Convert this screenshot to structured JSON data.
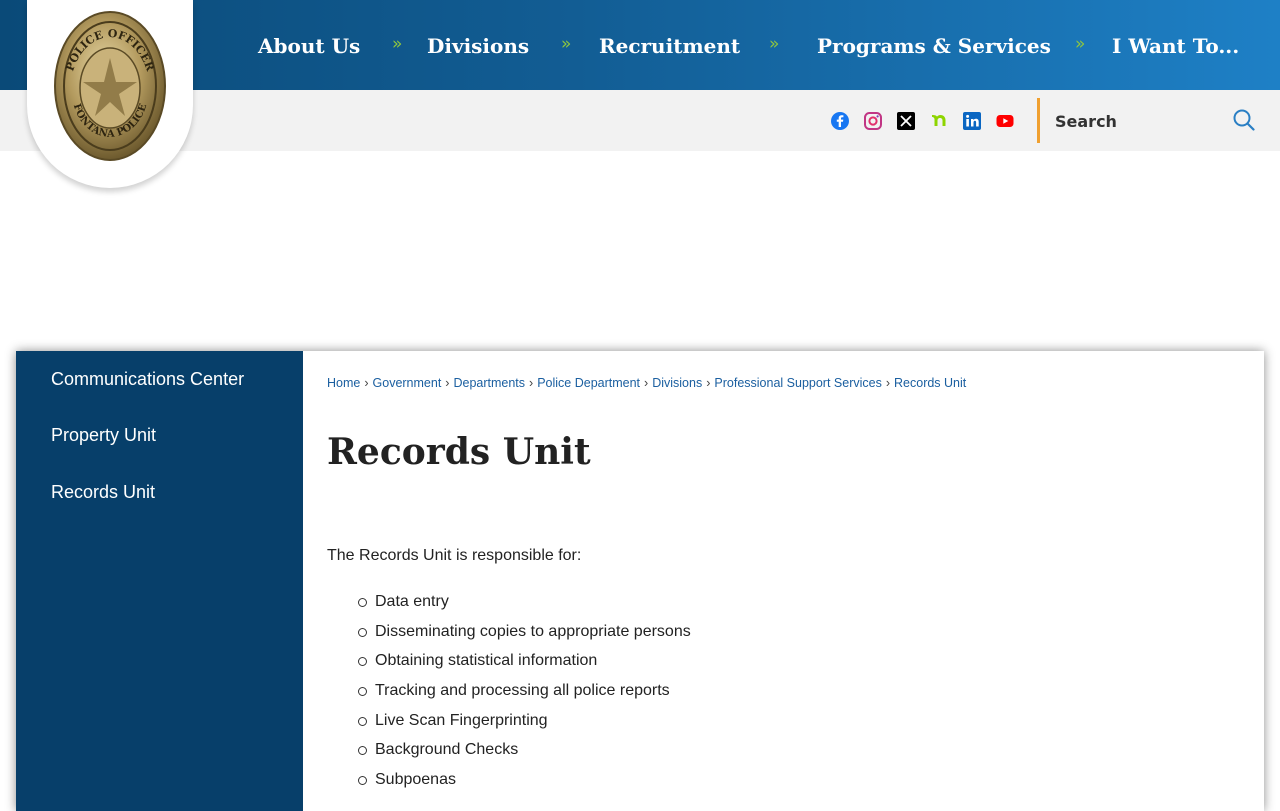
{
  "header": {
    "nav": [
      {
        "label": "About Us"
      },
      {
        "label": "Divisions"
      },
      {
        "label": "Recruitment"
      },
      {
        "label": "Programs & Services"
      },
      {
        "label": "I Want To..."
      }
    ],
    "separator": "»",
    "logo": {
      "top_text": "POLICE OFFICER",
      "bottom_text": "FONTANA POLICE"
    }
  },
  "utility": {
    "social": [
      {
        "name": "facebook-icon",
        "color": "#1877f2"
      },
      {
        "name": "instagram-icon",
        "color": "#d62976"
      },
      {
        "name": "x-icon",
        "color": "#000000"
      },
      {
        "name": "nextdoor-icon",
        "color": "#8ed500"
      },
      {
        "name": "linkedin-icon",
        "color": "#0a66c2"
      },
      {
        "name": "youtube-icon",
        "color": "#ff0000"
      }
    ],
    "search": {
      "placeholder": "Search",
      "accent": "#f0a030",
      "icon": "search-icon"
    }
  },
  "sidebar": {
    "items": [
      {
        "label": "Communications Center"
      },
      {
        "label": "Property Unit"
      },
      {
        "label": "Records Unit"
      }
    ]
  },
  "breadcrumb": [
    "Home",
    "Government",
    "Departments",
    "Police Department",
    "Divisions",
    "Professional Support Services",
    "Records Unit"
  ],
  "main": {
    "title": "Records Unit",
    "intro": "The Records Unit is responsible for:",
    "duties": [
      "Data entry",
      "Disseminating copies to appropriate persons",
      "Obtaining statistical information",
      "Tracking and processing all police reports",
      "Live Scan Fingerprinting",
      "Background Checks",
      "Subpoenas"
    ]
  },
  "colors": {
    "nav_bg": "#125d94",
    "sidebar_bg": "#073f6a",
    "separator": "#8fc63f",
    "link": "#1b5fa0"
  }
}
